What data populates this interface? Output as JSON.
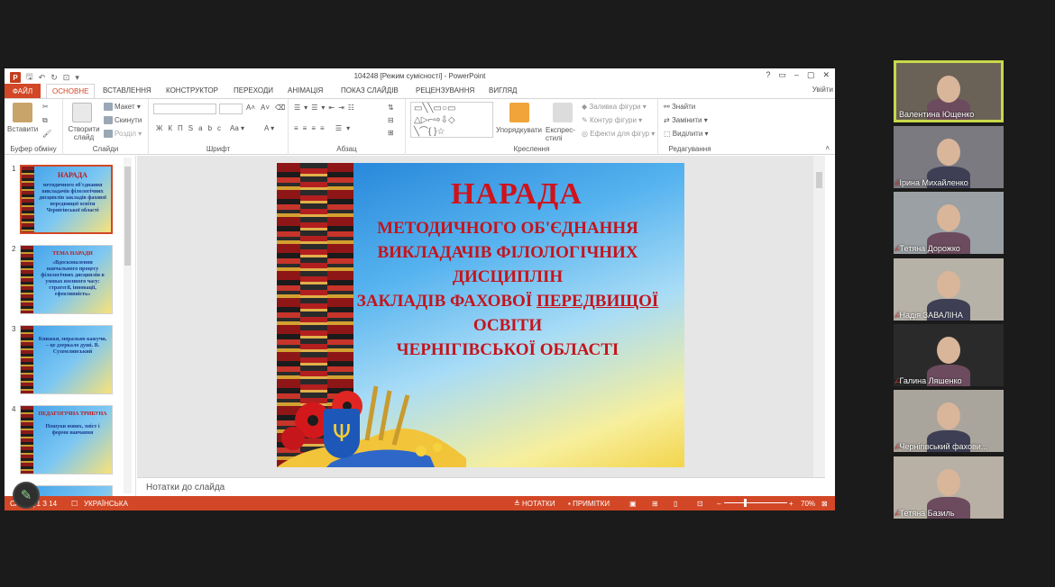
{
  "window": {
    "title": "104248 [Режим сумісності] - PowerPoint",
    "controls": [
      "?",
      "▭",
      "–",
      "▢",
      "✕"
    ]
  },
  "tabs": {
    "file": "ФАЙЛ",
    "items": [
      "ОСНОВНЕ",
      "ВСТАВЛЕННЯ",
      "КОНСТРУКТОР",
      "ПЕРЕХОДИ",
      "АНІМАЦІЯ",
      "ПОКАЗ СЛАЙДІВ",
      "РЕЦЕНЗУВАННЯ",
      "ВИГЛЯД"
    ],
    "active_index": 0,
    "signin": "Увійти"
  },
  "ribbon": {
    "clipboard": {
      "paste": "Вставити",
      "label": "Буфер обміну"
    },
    "slides": {
      "new_slide": "Створити слайд",
      "layout": "Макет",
      "reset": "Скинути",
      "section": "Розділ",
      "label": "Слайди"
    },
    "font": {
      "label": "Шрифт"
    },
    "paragraph": {
      "label": "Абзац"
    },
    "drawing": {
      "arrange": "Упорядкувати",
      "quick_styles": "Експрес-стилі",
      "fill": "Заливка фігури",
      "outline": "Контур фігури",
      "effects": "Ефекти для фігур",
      "label": "Креслення"
    },
    "editing": {
      "find": "Знайти",
      "replace": "Замінити",
      "select": "Виділити",
      "label": "Редагування"
    }
  },
  "thumbnails": [
    {
      "num": "1",
      "title": "НАРАДА",
      "text": "методичного об'єднання викладачів філологічних дисциплін закладів фахової передвищої освіти Чернігівської області"
    },
    {
      "num": "2",
      "title": "ТЕМА НАРАДИ",
      "text": "«Вдосконалення навчального процесу філологічних дисциплін в умовах воєнного часу: стратегії, інновації, ефективність»"
    },
    {
      "num": "3",
      "title": "",
      "text": "Книжки, морально кажучи, – це дзеркало душі. В. Сухомлинський"
    },
    {
      "num": "4",
      "title": "ПЕДАГОГІЧНА ТРИБУНА",
      "text": "Пошуки нових, зміст і форми навчання"
    },
    {
      "num": "5",
      "title": "",
      "text": ""
    }
  ],
  "slide": {
    "heading": "НАРАДА",
    "line1": "МЕТОДИЧНОГО ОБ'ЄДНАННЯ",
    "line2": "ВИКЛАДАЧІВ ФІЛОЛОГІЧНИХ",
    "line3": "ДИСЦИПЛІН",
    "line4_a": "ЗАКЛАДІВ ФАХОВОЇ ",
    "line4_b": "ПЕРЕДВИЩОЇ",
    "line5": "ОСВІТИ",
    "line6": "ЧЕРНІГІВСЬКОЇ ОБЛАСТІ"
  },
  "notes_placeholder": "Нотатки до слайда",
  "status": {
    "slide_counter": "СЛАЙД 1 З 14",
    "language": "УКРАЇНСЬКА",
    "notes": "НОТАТКИ",
    "comments": "ПРИМІТКИ",
    "zoom": "70%",
    "zoom_fraction": 0.7
  },
  "participants": [
    {
      "name": "Валентина Ющенко",
      "speaking": true,
      "muted": false,
      "bg": "#6b6257"
    },
    {
      "name": "Ірина Михайленко",
      "speaking": false,
      "muted": true,
      "bg": "#7b7a80"
    },
    {
      "name": "Тетяна Дорожко",
      "speaking": false,
      "muted": true,
      "bg": "#9aa0a3"
    },
    {
      "name": "Надія ЗАВАЛІНА",
      "speaking": false,
      "muted": true,
      "bg": "#b7b2a8"
    },
    {
      "name": "Галина Ляшенко",
      "speaking": false,
      "muted": true,
      "bg": "#2a2a2a"
    },
    {
      "name": "Чернігівський фахови...",
      "speaking": false,
      "muted": true,
      "bg": "#aaa59c"
    },
    {
      "name": "Тетяна Базиль",
      "speaking": false,
      "muted": true,
      "bg": "#b8b0a4"
    }
  ]
}
